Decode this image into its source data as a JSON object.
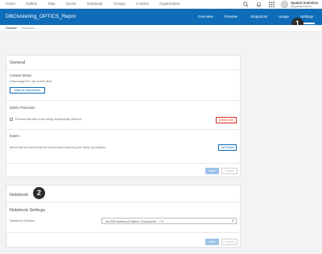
{
  "top_nav": {
    "links": [
      "Home",
      "Gallery",
      "Map",
      "Scene",
      "Notebook",
      "Groups",
      "Content",
      "Organization"
    ],
    "icons": [
      "search-icon",
      "bell-icon",
      "apps-grid-icon"
    ],
    "user": {
      "name": "Spatial Statistics",
      "handle": "@spatialstatistics"
    }
  },
  "item_header": {
    "title": "DBClustering_OPTICS_Repro",
    "tabs": [
      "Overview",
      "Preview",
      "Snapshots",
      "Usage",
      "Settings"
    ],
    "active_tab": "Settings",
    "accent": "#0e6cb8"
  },
  "sub_tabs": {
    "items": [
      "General",
      "Notebook"
    ],
    "active": "General"
  },
  "general": {
    "title": "General",
    "content_status": {
      "heading": "Content Status",
      "description": "Discourage the use of this item.",
      "button": "Mark as Deprecated"
    },
    "delete_protection": {
      "heading": "Delete Protection",
      "checkbox_label": "Prevent this item from being accidentally deleted.",
      "checked": false,
      "button": "Delete Item"
    },
    "extent": {
      "heading": "Extent",
      "description": "Items with an extent can be found when searching for items by location.",
      "button": "Set Extent"
    },
    "save": "Save",
    "cancel": "Cancel"
  },
  "notebook": {
    "title": "Notebook",
    "settings_heading": "Notebook Settings",
    "runtime_label": "Notebook Runtime",
    "runtime_value": "ArcGIS Notebook Python 3 Advanced - 7.0",
    "save": "Save",
    "cancel": "Cancel"
  },
  "callouts": [
    "1",
    "2"
  ]
}
